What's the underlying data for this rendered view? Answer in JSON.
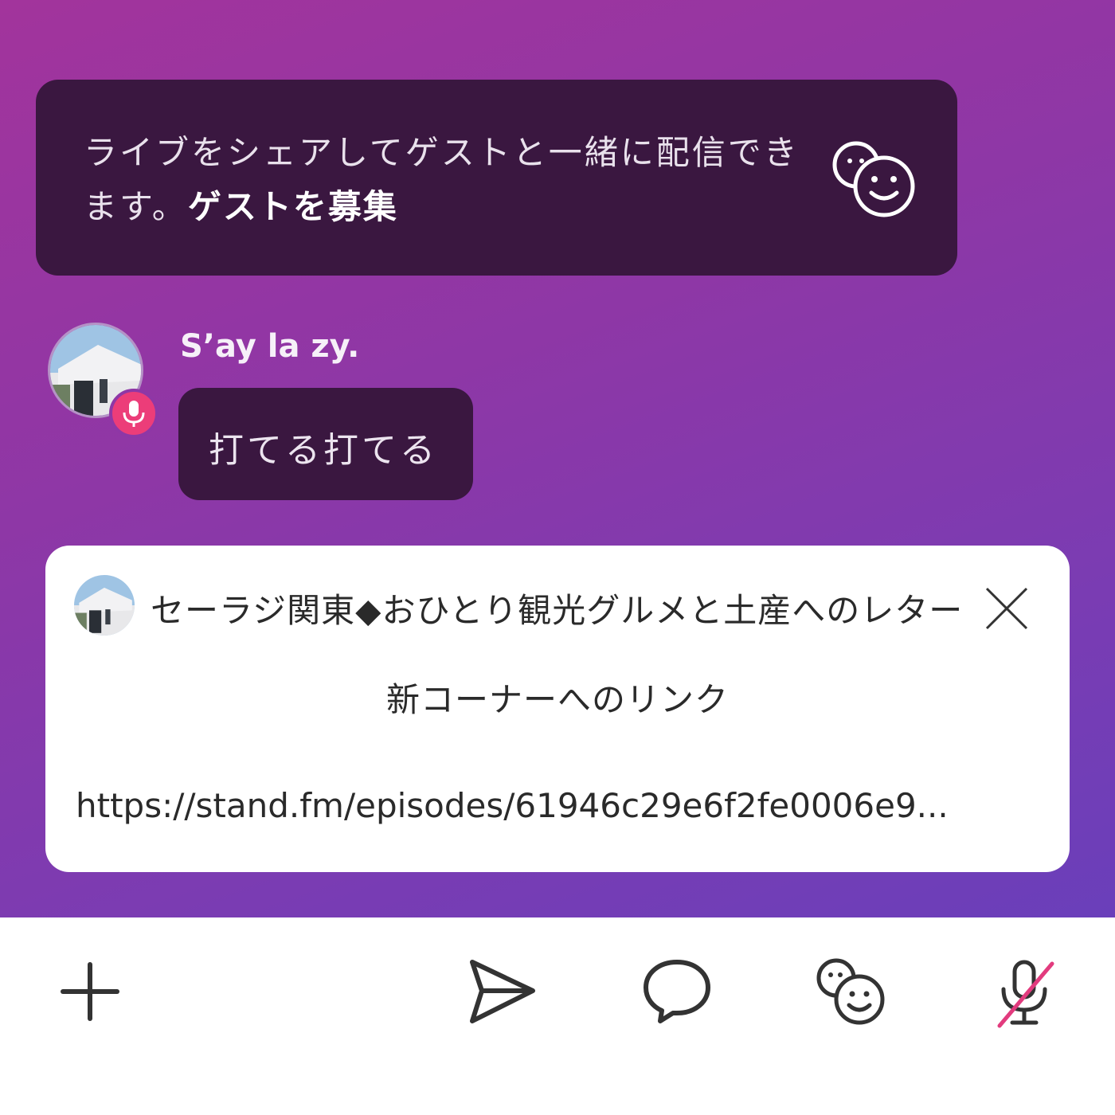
{
  "guest_banner": {
    "text": "ライブをシェアしてゲストと一緒に配信できます。",
    "link": "ゲストを募集",
    "icon": "guest-faces-icon"
  },
  "message": {
    "username": "S’ay la zy.",
    "text": "打てる打てる",
    "badge_icon": "microphone-icon"
  },
  "pinned_card": {
    "title": "セーラジ関東◆おひとり観光グルメと土産へのレター",
    "body_line1": "新コーナーへのリンク",
    "body_line2": "https://stand.fm/episodes/61946c29e6f2fe0006e9..."
  },
  "toolbar": {
    "items": [
      "plus-icon",
      "send-icon",
      "comment-icon",
      "guest-icon",
      "mic-muted-icon"
    ]
  },
  "colors": {
    "banner_bg": "#3a1740",
    "gradient_start": "#a2349c",
    "gradient_end": "#6a3fba",
    "mic_badge": "#ec3d79"
  }
}
